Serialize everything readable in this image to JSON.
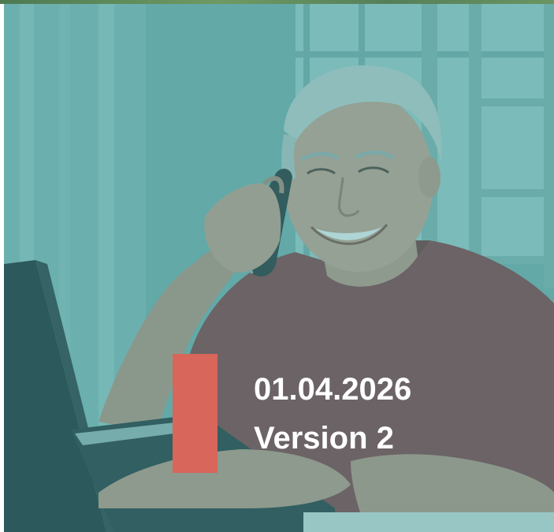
{
  "cover": {
    "date": "01.04.2026",
    "version": "Version 2",
    "photo_subject": "smiling older man on phone at laptop",
    "overlay_color": "#3f9a9c",
    "accent_color": "#d8665a",
    "shirt_color": "#8c3b3f"
  }
}
